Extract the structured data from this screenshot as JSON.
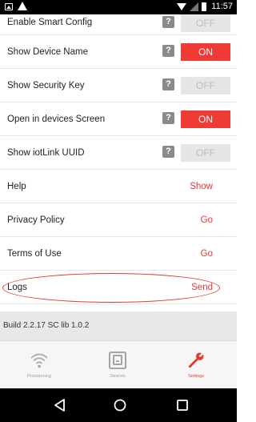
{
  "status_bar": {
    "time": "11:57",
    "icons": [
      "image-icon",
      "warning-icon",
      "wifi-icon",
      "signal-icon",
      "battery-icon"
    ]
  },
  "settings": {
    "toggles": [
      {
        "label": "Enable Smart Config",
        "help": "?",
        "state": "OFF"
      },
      {
        "label": "Show Device Name",
        "help": "?",
        "state": "ON"
      },
      {
        "label": "Show Security Key",
        "help": "?",
        "state": "OFF"
      },
      {
        "label": "Open in devices Screen",
        "help": "?",
        "state": "ON"
      },
      {
        "label": "Show iotLink UUID",
        "help": "?",
        "state": "OFF"
      }
    ],
    "links": [
      {
        "label": "Help",
        "action": "Show"
      },
      {
        "label": "Privacy Policy",
        "action": "Go"
      },
      {
        "label": "Terms of Use",
        "action": "Go"
      },
      {
        "label": "Logs",
        "action": "Send"
      }
    ],
    "highlighted_row": "Logs",
    "highlight_color": "#e33a30",
    "build": "Build 2.2.17 SC lib 1.0.2"
  },
  "tabs": [
    {
      "label": "Provisioning",
      "icon": "wifi-icon",
      "active": false
    },
    {
      "label": "Devices",
      "icon": "device-icon",
      "active": false
    },
    {
      "label": "Settings",
      "icon": "wrench-icon",
      "active": true
    }
  ],
  "colors": {
    "accent": "#e33a30",
    "toggle_on": "#f03a35",
    "toggle_off": "#e6e6e6"
  },
  "nav_bar": {
    "buttons": [
      "back-icon",
      "home-icon",
      "recents-icon"
    ]
  }
}
